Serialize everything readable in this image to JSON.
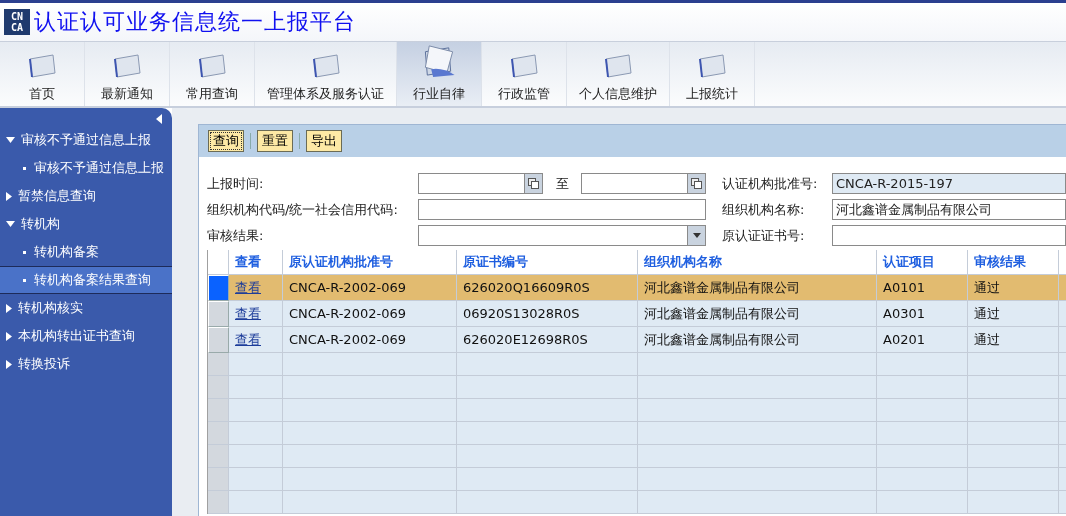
{
  "header": {
    "logo": [
      "CN",
      "CA"
    ],
    "title": "认证认可业务信息统一上报平台"
  },
  "nav": [
    {
      "label": "首页",
      "selected": false
    },
    {
      "label": "最新通知",
      "selected": false
    },
    {
      "label": "常用查询",
      "selected": false
    },
    {
      "label": "管理体系及服务认证",
      "selected": false
    },
    {
      "label": "行业自律",
      "selected": true
    },
    {
      "label": "行政监管",
      "selected": false
    },
    {
      "label": "个人信息维护",
      "selected": false
    },
    {
      "label": "上报统计",
      "selected": false
    }
  ],
  "sidebar": {
    "items": [
      {
        "label": "审核不予通过信息上报",
        "expanded": true,
        "children": [
          {
            "label": "审核不予通过信息上报",
            "selected": false
          }
        ]
      },
      {
        "label": "暂禁信息查询",
        "expanded": false
      },
      {
        "label": "转机构",
        "expanded": true,
        "children": [
          {
            "label": "转机构备案",
            "selected": false
          },
          {
            "label": "转机构备案结果查询",
            "selected": true
          }
        ]
      },
      {
        "label": "转机构核实",
        "expanded": false
      },
      {
        "label": "本机构转出证书查询",
        "expanded": false
      },
      {
        "label": "转换投诉",
        "expanded": false
      }
    ]
  },
  "toolbar": [
    {
      "label": "查询",
      "focused": true
    },
    {
      "label": "重置",
      "focused": false
    },
    {
      "label": "导出",
      "focused": false
    }
  ],
  "form": {
    "report_time_label": "上报时间:",
    "to_label": "至",
    "approval_label": "认证机构批准号:",
    "approval_value": "CNCA-R-2015-197",
    "org_code_label": "组织机构代码/统一社会信用代码:",
    "org_name_label": "组织机构名称:",
    "org_name_value": "河北鑫谱金属制品有限公司",
    "result_label": "审核结果:",
    "cert_label": "原认证证书号:"
  },
  "table": {
    "columns": [
      "查看",
      "原认证机构批准号",
      "原证书编号",
      "组织机构名称",
      "认证项目",
      "审核结果"
    ],
    "rows": [
      {
        "selected": true,
        "cells": [
          "查看",
          "CNCA-R-2002-069",
          "626020Q16609R0S",
          "河北鑫谱金属制品有限公司",
          "A0101",
          "通过"
        ]
      },
      {
        "selected": false,
        "cells": [
          "查看",
          "CNCA-R-2002-069",
          "06920S13028R0S",
          "河北鑫谱金属制品有限公司",
          "A0301",
          "通过"
        ]
      },
      {
        "selected": false,
        "cells": [
          "查看",
          "CNCA-R-2002-069",
          "626020E12698R0S",
          "河北鑫谱金属制品有限公司",
          "A0201",
          "通过"
        ]
      }
    ]
  }
}
